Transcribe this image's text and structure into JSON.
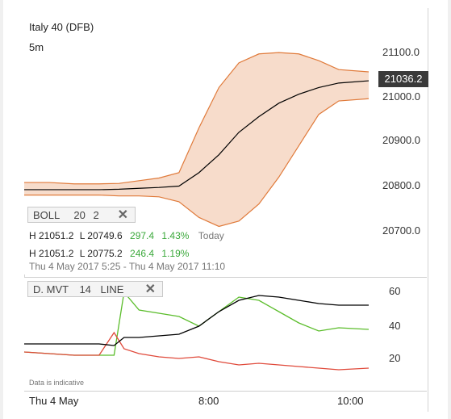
{
  "header": {
    "instrument": "Italy 40 (DFB)",
    "interval": "5m"
  },
  "price_axis": {
    "labels": [
      "21100.0",
      "21000.0",
      "20900.0",
      "20800.0",
      "20700.0"
    ],
    "current": "21036.2"
  },
  "indicator_boll": {
    "label": "BOLL",
    "period": "20",
    "dev": "2"
  },
  "stats_today": {
    "high": "H 21051.2",
    "low": "L 20749.6",
    "change": "297.4",
    "pct": "1.43%",
    "period": "Today"
  },
  "stats_range": {
    "high": "H 21051.2",
    "low": "L 20775.2",
    "change": "246.4",
    "pct": "1.19%"
  },
  "date_range": "Thu 4 May 2017 5:25 - Thu 4 May 2017 11:10",
  "indicator_dmvt": {
    "label": "D. MVT",
    "period": "14",
    "style": "LINE"
  },
  "dmvt_axis": {
    "labels": [
      "60",
      "40",
      "20"
    ]
  },
  "disclaimer": "Data is indicative",
  "time_axis": {
    "labels": [
      "Thu 4 May",
      "8:00",
      "10:00"
    ]
  },
  "colors": {
    "up": "#5bbd2b",
    "down": "#e04a3b",
    "band_fill": "#f7dccb",
    "band_line": "#e07a3a",
    "ma": "#000000"
  },
  "chart_data": [
    {
      "type": "candlestick",
      "series": [
        {
          "name": "BOLL",
          "x": [
            "5:25",
            "5:50",
            "6:15",
            "6:40",
            "7:00",
            "7:20",
            "7:40",
            "8:00",
            "8:20",
            "8:40",
            "9:00",
            "9:20",
            "9:40",
            "10:00",
            "10:20",
            "10:40",
            "11:10"
          ],
          "upper": [
            20808,
            20808,
            20805,
            20805,
            20806,
            20812,
            20818,
            20830,
            20930,
            21020,
            21075,
            21095,
            21098,
            21095,
            21080,
            21060,
            21055
          ],
          "middle": [
            20792,
            20792,
            20792,
            20792,
            20793,
            20795,
            20797,
            20800,
            20830,
            20870,
            20920,
            20955,
            20985,
            21005,
            21020,
            21030,
            21035
          ],
          "lower": [
            20780,
            20780,
            20780,
            20780,
            20778,
            20778,
            20776,
            20765,
            20730,
            20710,
            20722,
            20760,
            20820,
            20890,
            20960,
            20990,
            20995
          ]
        }
      ],
      "ylim": [
        20680,
        21120
      ]
    },
    {
      "type": "line",
      "x": [
        "5:25",
        "5:50",
        "6:15",
        "6:40",
        "6:55",
        "7:05",
        "7:20",
        "7:40",
        "8:00",
        "8:20",
        "8:40",
        "9:00",
        "9:20",
        "9:40",
        "10:00",
        "10:20",
        "10:40",
        "11:10"
      ],
      "series": [
        {
          "name": "green",
          "values": [
            23,
            22,
            21,
            21,
            21,
            60,
            49,
            47,
            45,
            39,
            48,
            57,
            55,
            48,
            41,
            36,
            38,
            37
          ]
        },
        {
          "name": "red",
          "values": [
            23,
            22,
            21,
            21,
            35,
            25,
            22,
            20,
            19,
            20,
            17,
            15,
            16,
            15,
            14,
            13,
            12,
            13
          ]
        },
        {
          "name": "black",
          "values": [
            28,
            28,
            28,
            28,
            27,
            32,
            32,
            33,
            34,
            39,
            48,
            55,
            58,
            57,
            55,
            53,
            52,
            52
          ]
        }
      ],
      "ylim": [
        6,
        68
      ]
    }
  ]
}
